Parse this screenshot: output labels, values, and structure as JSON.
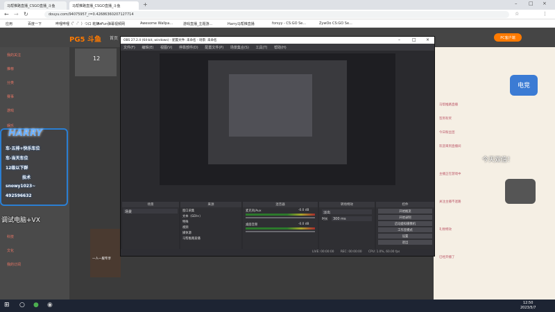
{
  "browser": {
    "tabs": [
      "斗鱼网",
      "马帮推路直播_CSGO直播_斗鱼",
      "马帮推路直播_CSGO直播_斗鱼"
    ],
    "url": "douyu.com/94075957_r=0.42686360207127714",
    "bookmarks": [
      "应用",
      "百度一下",
      "哔哩哔哩（゜-゜）つロ 乾杯~",
      "AcFun弹幕视频网",
      "Awesome Wallpa...",
      "游戏直播_主题游...",
      "Harry马帮推直播",
      "forsyy - CS:GO Se...",
      "ZywOo CS:GO Se..."
    ]
  },
  "site": {
    "logo": "PG5 斗鱼",
    "nav": [
      "首页"
    ],
    "streamer_count": "12",
    "left_menu": [
      "我的关注",
      "推荐",
      "分类",
      "赛事",
      "游戏",
      "娱乐",
      "科技",
      "文化",
      "我的订阅"
    ],
    "right_header": "PC客户端",
    "right_badge": "电竞",
    "chat_lines": [
      "马帮推路直播",
      "签到有奖",
      "今日粉丝团",
      "欢迎来到直播间",
      "主播正在游戏中",
      "关注主播不迷路",
      "礼物特效",
      "已经开播了"
    ],
    "overlay_text": "今天双倍！",
    "promo": "一人一服专享"
  },
  "obs": {
    "title": "OBS 27.2.4 (64-bit, windows) - 配置文件: 未命名 - 场景: 未命名",
    "menu": [
      "文件(F)",
      "编辑(E)",
      "视图(V)",
      "停靠部件(D)",
      "配置文件(P)",
      "场景集合(S)",
      "工具(T)",
      "帮助(H)"
    ],
    "docks": {
      "scenes": "场景",
      "sources": "来源",
      "mixer": "混音器",
      "transitions": "转场特效",
      "controls": "控件"
    },
    "scene_item": "场景",
    "sources": [
      "窗口采集",
      "文本（GDI+）",
      "特殊",
      "视频",
      "媒体源",
      "马帮推路直播"
    ],
    "mixer_channels": [
      {
        "name": "桌面音频",
        "db": "-0.0 dB"
      },
      {
        "name": "麦克风/Aux",
        "db": "-0.0 dB"
      }
    ],
    "transition": {
      "type": "淡出",
      "duration_label": "时长",
      "duration": "300 ms"
    },
    "controls": [
      "开始推流",
      "开始录制",
      "启动虚拟摄像机",
      "工作室模式",
      "设置",
      "退出"
    ],
    "status": {
      "live": "LIVE: 00:00:00",
      "rec": "REC: 00:00:00",
      "cpu": "CPU: 1.0%, 60.00 fps"
    }
  },
  "overlay": {
    "harry_title": "HARRY",
    "lines": [
      "车-五排+快乐车位",
      "车-当天车位",
      "12级以下群",
      "技术",
      "snowy1023~",
      "492596632"
    ],
    "vx": "调试电脑+VX"
  },
  "taskbar": {
    "time": "12:50",
    "date": "2023/5/7"
  },
  "colors": {
    "accent_orange": "#ff7a00",
    "obs_bg": "#2a2a2e",
    "overlay_blue": "#2a7fd4"
  }
}
